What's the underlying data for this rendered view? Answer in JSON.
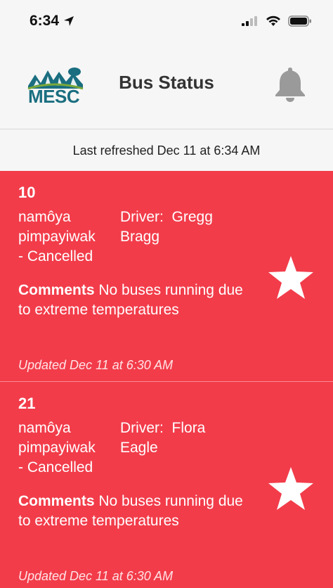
{
  "status": {
    "time": "6:34"
  },
  "header": {
    "title": "Bus Status",
    "logo_text": "MESC"
  },
  "refresh": {
    "text": "Last refreshed Dec 11 at 6:34 AM"
  },
  "buses": [
    {
      "route": "10",
      "name_line1": "namôya",
      "name_line2": "pimpayiwak",
      "name_line3": "- Cancelled",
      "driver_label": "Driver:",
      "driver_first": "Gregg",
      "driver_last": "Bragg",
      "comments_label": "Comments",
      "comments": "No buses running due to extreme temperatures",
      "updated": "Updated Dec 11 at 6:30 AM"
    },
    {
      "route": "21",
      "name_line1": "namôya",
      "name_line2": "pimpayiwak",
      "name_line3": "- Cancelled",
      "driver_label": "Driver:",
      "driver_first": "Flora",
      "driver_last": "Eagle",
      "comments_label": "Comments",
      "comments": "No buses running due to extreme temperatures",
      "updated": "Updated Dec 11 at 6:30 AM"
    }
  ],
  "colors": {
    "card": "#f23c4a",
    "logo": "#1a6e80",
    "bell": "#9a9a9a"
  }
}
